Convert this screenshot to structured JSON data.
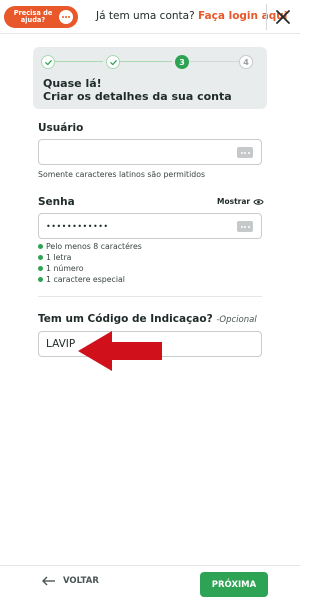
{
  "header": {
    "help_label": "Precisa de ajuda?",
    "login_prompt": "Já tem uma conta?",
    "login_link": "Faça login aqui"
  },
  "stepper": {
    "steps": [
      {
        "label": "",
        "state": "done",
        "icon": "check-icon"
      },
      {
        "label": "",
        "state": "done",
        "icon": "check-icon"
      },
      {
        "label": "3",
        "state": "active"
      },
      {
        "label": "4",
        "state": "pending"
      }
    ],
    "title_line1": "Quase lá!",
    "title_line2": "Criar os detalhes da sua conta"
  },
  "username": {
    "label": "Usuário",
    "value": "",
    "hint": "Somente caracteres latinos são permitidos"
  },
  "password": {
    "label": "Senha",
    "show_label": "Mostrar",
    "value": "••••••••••••",
    "rules": [
      "Pelo menos 8 caractéres",
      "1 letra",
      "1 número",
      "1 caractere especial"
    ]
  },
  "referral": {
    "label": "Tem um Código de Indicaçao?",
    "optional": "-Opcional",
    "value": "LAVIP"
  },
  "footer": {
    "back_label": "VOLTAR",
    "next_label": "PRÓXIMA"
  },
  "colors": {
    "brand_orange": "#e8582a",
    "brand_green": "#2ea353",
    "arrow_red": "#d0101a"
  }
}
